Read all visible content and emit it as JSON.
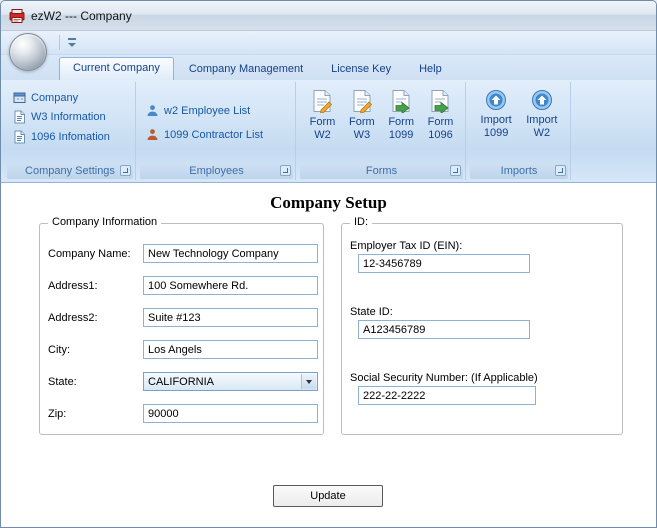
{
  "window": {
    "title": "ezW2 --- Company"
  },
  "tabs": [
    {
      "label": "Current Company",
      "active": true
    },
    {
      "label": "Company Management",
      "active": false
    },
    {
      "label": "License Key",
      "active": false
    },
    {
      "label": "Help",
      "active": false
    }
  ],
  "ribbon": {
    "groups": [
      {
        "caption": "Company Settings",
        "items": [
          {
            "label": "Company",
            "icon": "company-icon"
          },
          {
            "label": "W3 Information",
            "icon": "w3-document-icon"
          },
          {
            "label": "1096 Infomation",
            "icon": "document-1096-icon"
          }
        ]
      },
      {
        "caption": "Employees",
        "items": [
          {
            "label": "w2 Employee List",
            "icon": "employee-person-icon"
          },
          {
            "label": "1099 Contractor List",
            "icon": "contractor-person-icon"
          }
        ]
      },
      {
        "caption": "Forms",
        "items": [
          {
            "line1": "Form",
            "line2": "W2",
            "icon": "form-edit-icon"
          },
          {
            "line1": "Form",
            "line2": "W3",
            "icon": "form-edit-icon"
          },
          {
            "line1": "Form",
            "line2": "1099",
            "icon": "form-export-icon"
          },
          {
            "line1": "Form",
            "line2": "1096",
            "icon": "form-export-icon"
          }
        ]
      },
      {
        "caption": "Imports",
        "items": [
          {
            "line1": "Import",
            "line2": "1099",
            "icon": "import-icon"
          },
          {
            "line1": "Import",
            "line2": "W2",
            "icon": "import-icon"
          }
        ]
      }
    ]
  },
  "main": {
    "title": "Company Setup",
    "company_info": {
      "caption": "Company Information",
      "fields": [
        {
          "label": "Company Name:",
          "value": "New Technology Company"
        },
        {
          "label": "Address1:",
          "value": "100 Somewhere Rd."
        },
        {
          "label": "Address2:",
          "value": "Suite #123"
        },
        {
          "label": "City:",
          "value": "Los Angels"
        },
        {
          "label": "State:",
          "value": "CALIFORNIA"
        },
        {
          "label": "Zip:",
          "value": "90000"
        }
      ]
    },
    "id_info": {
      "caption": "ID:",
      "fields": [
        {
          "label": "Employer Tax ID (EIN):",
          "value": "12-3456789"
        },
        {
          "label": "State ID:",
          "value": "A123456789"
        },
        {
          "label": "Social Security Number: (If Applicable)",
          "value": "222-22-2222"
        }
      ]
    },
    "update_button": "Update"
  }
}
